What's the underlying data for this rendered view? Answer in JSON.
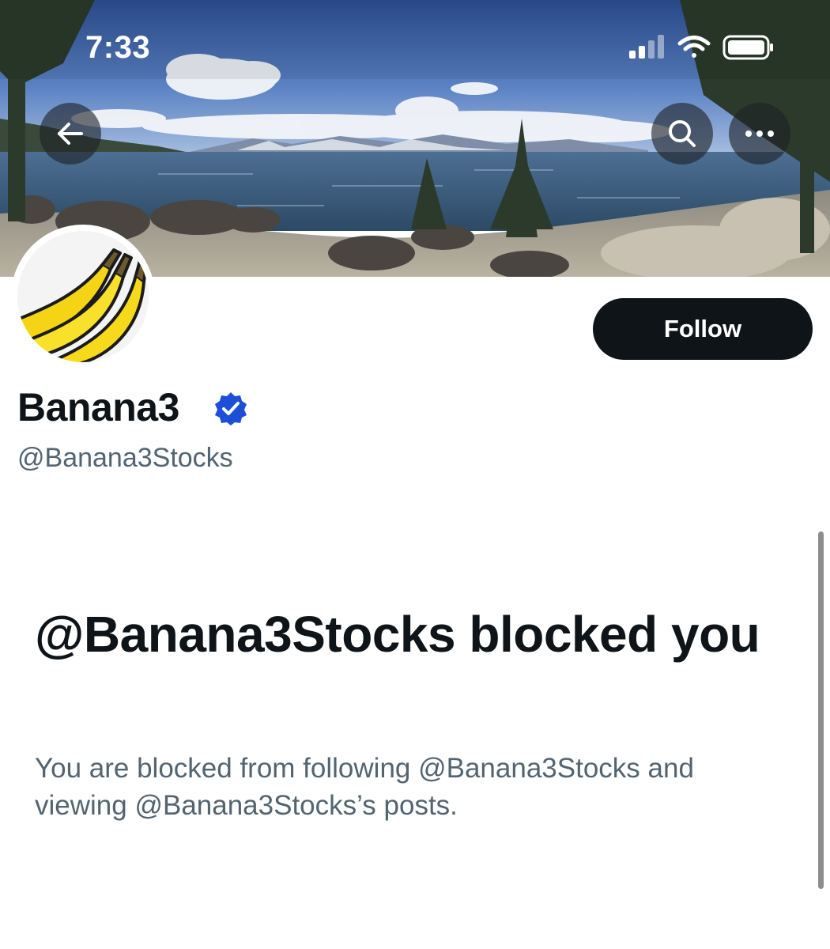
{
  "status_bar": {
    "time": "7:33",
    "signal_icon": "cellular-signal-icon",
    "wifi_icon": "wifi-icon",
    "battery_icon": "battery-icon"
  },
  "header": {
    "back_icon": "arrow-left-icon",
    "search_icon": "search-icon",
    "more_icon": "more-dots-icon",
    "banner_image": "lake-landscape-banner"
  },
  "profile": {
    "avatar": "banana-avatar",
    "display_name": "Banana3",
    "verified": true,
    "verified_color": "#1d4ed8",
    "handle": "@Banana3Stocks",
    "follow_label": "Follow"
  },
  "blocked_notice": {
    "title": "@Banana3Stocks blocked you",
    "description": "You are blocked from following @Banana3Stocks and viewing @Banana3Stocks’s posts."
  },
  "colors": {
    "text_primary": "#0f1419",
    "text_secondary": "#536471",
    "button_bg": "#0f1419"
  }
}
